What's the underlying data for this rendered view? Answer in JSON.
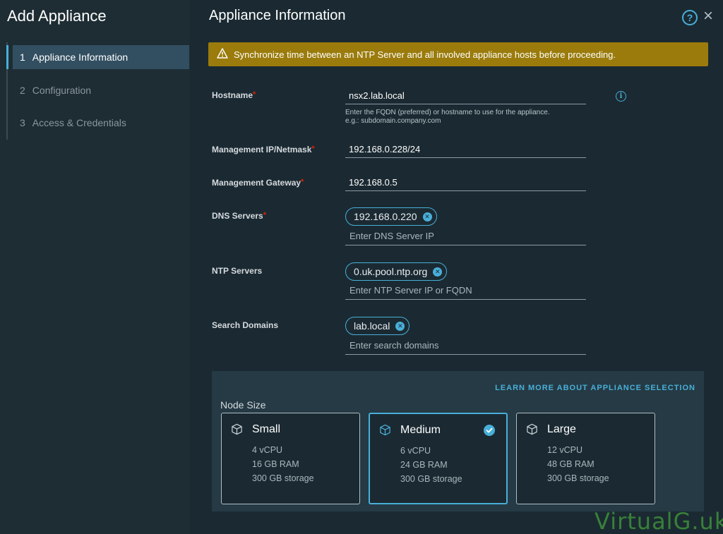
{
  "sidebar": {
    "title": "Add Appliance",
    "steps": [
      {
        "num": "1",
        "label": "Appliance Information",
        "active": true
      },
      {
        "num": "2",
        "label": "Configuration",
        "active": false
      },
      {
        "num": "3",
        "label": "Access & Credentials",
        "active": false
      }
    ]
  },
  "main": {
    "title": "Appliance Information",
    "help_icon": "?",
    "close_icon": "×",
    "warning": "Synchronize time between an NTP Server and all involved appliance hosts before proceeding.",
    "required_mark": "*",
    "fields": {
      "hostname": {
        "label": "Hostname",
        "value": "nsx2.lab.local",
        "helper_1": "Enter the FQDN (preferred) or hostname to use for the appliance.",
        "helper_2": "e.g.: subdomain.company.com"
      },
      "mgmt_ip": {
        "label": "Management IP/Netmask",
        "value": "192.168.0.228/24"
      },
      "mgmt_gw": {
        "label": "Management Gateway",
        "value": "192.168.0.5"
      },
      "dns": {
        "label": "DNS Servers",
        "chip": "192.168.0.220",
        "placeholder": "Enter DNS Server IP"
      },
      "ntp": {
        "label": "NTP Servers",
        "chip": "0.uk.pool.ntp.org",
        "placeholder": "Enter NTP Server IP or FQDN"
      },
      "search": {
        "label": "Search Domains",
        "chip": "lab.local",
        "placeholder": "Enter search domains"
      }
    },
    "node": {
      "learn_more": "LEARN MORE ABOUT APPLIANCE SELECTION",
      "label": "Node Size",
      "cards": [
        {
          "title": "Small",
          "cpu": "4 vCPU",
          "ram": "16 GB RAM",
          "storage": "300 GB storage",
          "selected": false
        },
        {
          "title": "Medium",
          "cpu": "6 vCPU",
          "ram": "24 GB RAM",
          "storage": "300 GB storage",
          "selected": true
        },
        {
          "title": "Large",
          "cpu": "12 vCPU",
          "ram": "48 GB RAM",
          "storage": "300 GB storage",
          "selected": false
        }
      ]
    }
  },
  "watermark": "VirtualG.uk",
  "colors": {
    "accent": "#49afd9",
    "warning": "#9a7b0c",
    "required": "#e12200",
    "background": "#1b2a32"
  }
}
